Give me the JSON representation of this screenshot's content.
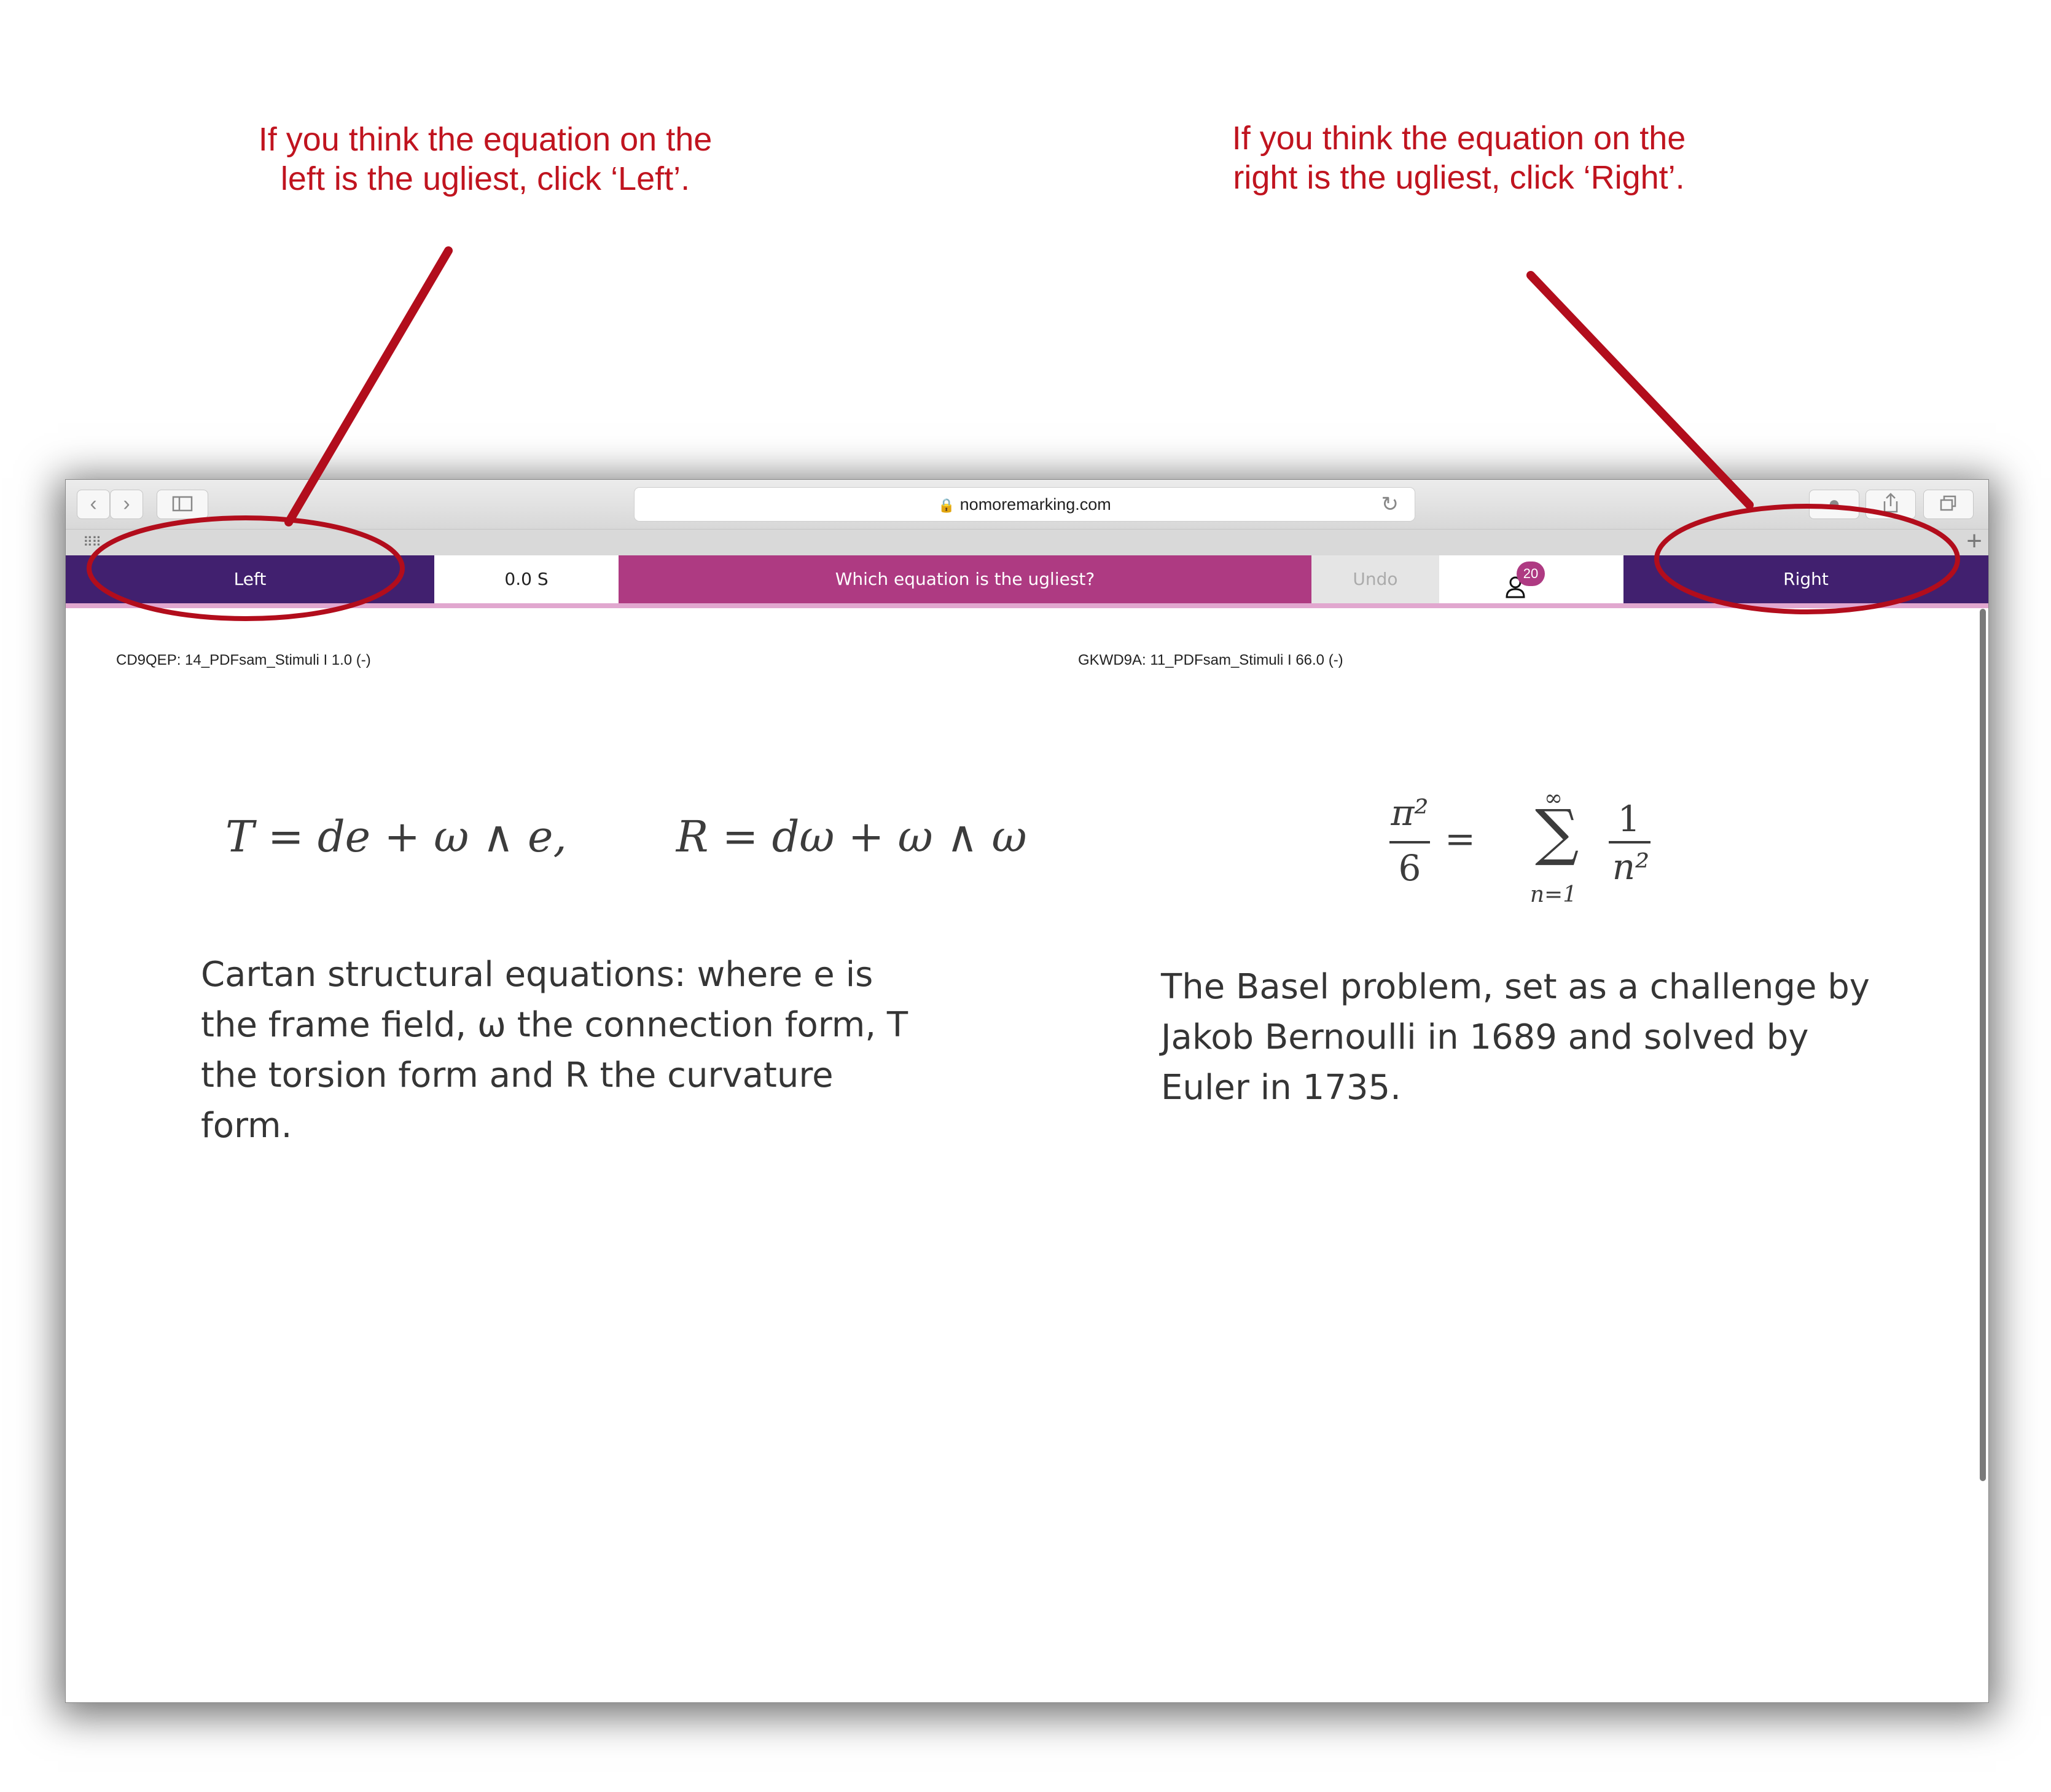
{
  "annotations": {
    "left_instruction": "If you think the equation on the left is the ugliest, click ‘Left’.",
    "right_instruction": "If you think the equation on the right is the ugliest, click ‘Right’."
  },
  "browser": {
    "url": "nomoremarking.com"
  },
  "appbar": {
    "left_label": "Left",
    "timer": "0.0 S",
    "question": "Which equation is the ugliest?",
    "undo_label": "Undo",
    "badge_count": "20",
    "right_label": "Right"
  },
  "left_item": {
    "meta": "CD9QEP: 14_PDFsam_Stimuli  I 1.0 (-)",
    "equation": "T = de + ω ∧ e,        R = dω + ω ∧ ω",
    "description": "Cartan structural equations: where e is the frame field, ω the connection form, T the torsion form and R the curvature form."
  },
  "right_item": {
    "meta": "GKWD9A: 11_PDFsam_Stimuli  I 66.0 (-)",
    "equation_lhs_num": "π²",
    "equation_lhs_den": "6",
    "equation_eq": "=",
    "sum_symbol": "∑",
    "sum_upper": "∞",
    "sum_lower": "n=1",
    "equation_rhs_num": "1",
    "equation_rhs_den": "n²",
    "description": "The Basel problem, set as a challenge by Jakob Bernoulli in 1689 and solved by Euler in 1735."
  },
  "colors": {
    "annotation_red": "#c0141f",
    "button_purple": "#41206f",
    "question_magenta": "#ae3a82"
  }
}
